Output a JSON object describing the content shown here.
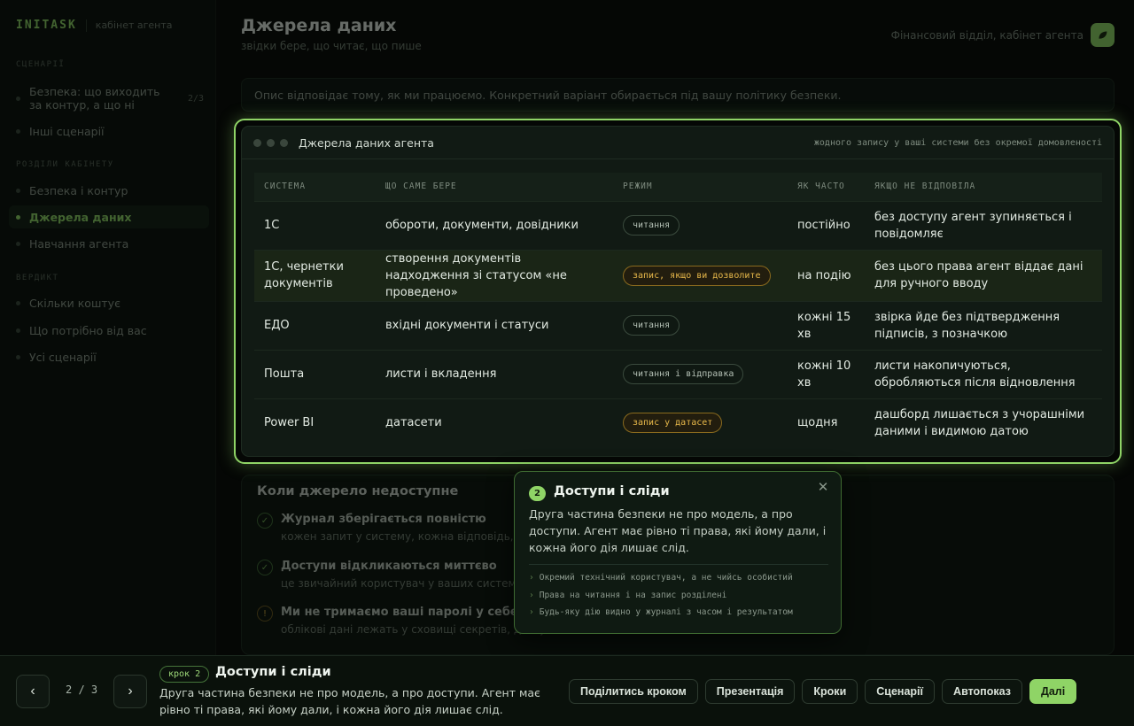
{
  "brand": {
    "logo": "INITASK",
    "subtitle": "кабінет агента"
  },
  "sidebar": {
    "sections": [
      {
        "title": "СЦЕНАРІЇ",
        "items": [
          {
            "label": "Безпека: що виходить за контур, а що ні",
            "count": "2/3"
          },
          {
            "label": "Інші сценарії"
          }
        ]
      },
      {
        "title": "РОЗДІЛИ КАБІНЕТУ",
        "items": [
          {
            "label": "Безпека і контур"
          },
          {
            "label": "Джерела даних",
            "active": true
          },
          {
            "label": "Навчання агента"
          }
        ]
      },
      {
        "title": "ВЕРДИКТ",
        "items": [
          {
            "label": "Скільки коштує"
          },
          {
            "label": "Що потрібно від вас"
          },
          {
            "label": "Усі сценарії"
          }
        ]
      }
    ]
  },
  "header": {
    "title": "Джерела даних",
    "subtitle": "звідки бере, що читає, що пише",
    "org": "Фінансовий відділ, кабінет агента",
    "badge_icon": "leaf-icon"
  },
  "notice": "Опис відповідає тому, як ми працюємо. Конкретний варіант обирається під вашу політику безпеки.",
  "panel": {
    "title": "Джерела даних агента",
    "note": "жодного запису у ваші системи без окремої домовленості",
    "columns": [
      "СИСТЕМА",
      "ЩО САМЕ БЕРЕ",
      "РЕЖИМ",
      "ЯК ЧАСТО",
      "ЯКЩО НЕ ВІДПОВІЛА"
    ],
    "rows": [
      {
        "system": "1С",
        "takes": "обороти, документи, довідники",
        "mode": "читання",
        "mode_type": "read",
        "freq": "постійно",
        "fallback": "без доступу агент зупиняється і повідомляє"
      },
      {
        "system": "1С, чернетки документів",
        "takes": "створення документів надходження зі статусом «не проведено»",
        "mode": "запис, якщо ви дозволите",
        "mode_type": "write",
        "freq": "на подію",
        "fallback": "без цього права агент віддає дані для ручного вводу",
        "highlight": true
      },
      {
        "system": "ЕДО",
        "takes": "вхідні документи і статуси",
        "mode": "читання",
        "mode_type": "read",
        "freq": "кожні 15 хв",
        "fallback": "звірка йде без підтвердження підписів, з позначкою"
      },
      {
        "system": "Пошта",
        "takes": "листи і вкладення",
        "mode": "читання і відправка",
        "mode_type": "read",
        "freq": "кожні 10 хв",
        "fallback": "листи накопичуються, обробляються після відновлення"
      },
      {
        "system": "Power BI",
        "takes": "датасети",
        "mode": "запис у датасет",
        "mode_type": "write",
        "freq": "щодня",
        "fallback": "дашборд лишається з учорашніми даними і видимою датою"
      }
    ]
  },
  "background_card": {
    "title": "Коли джерело недоступне",
    "items": [
      {
        "title": "Журнал зберігається повністю",
        "text": "кожен запит у систему, кожна відповідь, кожна дія",
        "status": "ok"
      },
      {
        "title": "Доступи відкликаються миттєво",
        "text": "це звичайний користувач у ваших системах",
        "status": "ok"
      },
      {
        "title": "Ми не тримаємо ваші паролі у себе",
        "text": "облікові дані лежать у сховищі секретів, доступ за політикою",
        "status": "warn"
      }
    ]
  },
  "popover": {
    "number": "2",
    "title": "Доступи і сліди",
    "text": "Друга частина безпеки не про модель, а про доступи. Агент має рівно ті права, які йому дали, і кожна його дія лишає слід.",
    "bullets": [
      "Окремий технічний користувач, а не чийсь особистий",
      "Права на читання і на запис розділені",
      "Будь-яку дію видно у журналі з часом і результатом"
    ]
  },
  "bottom": {
    "pager": "2 / 3",
    "step_badge": "крок 2",
    "step_title": "Доступи і сліди",
    "step_text": "Друга частина безпеки не про модель, а про доступи. Агент має рівно ті права, які йому дали, і кожна його дія лишає слід.",
    "actions": [
      "Поділитись кроком",
      "Презентація",
      "Кроки",
      "Сценарії",
      "Автопоказ",
      "Далі"
    ]
  }
}
